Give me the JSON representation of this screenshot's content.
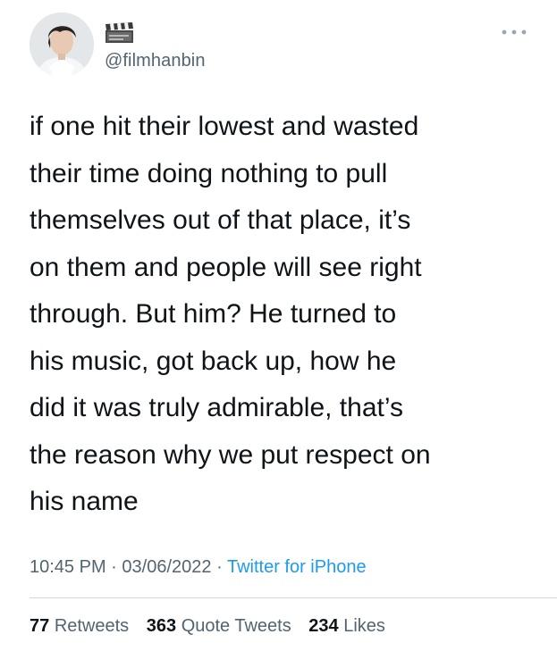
{
  "user": {
    "handle": "@filmhanbin",
    "name_icon": "film-clapper-emoji",
    "avatar_icon": "profile-photo"
  },
  "menu": {
    "icon": "more-options-icon"
  },
  "tweet": {
    "text": "if one hit their lowest and wasted\ntheir time doing nothing to pull\nthemselves out of that place, it’s\non them and people will see right\nthrough. But him? He turned to\nhis music, got back up, how he\ndid it was truly admirable, that’s\nthe reason why we put respect on\nhis name",
    "time": "10:45 PM",
    "date": "03/06/2022",
    "separator": "·",
    "source": "Twitter for iPhone"
  },
  "stats": {
    "retweets_count": "77",
    "retweets_label": "Retweets",
    "quotes_count": "363",
    "quotes_label": "Quote Tweets",
    "likes_count": "234",
    "likes_label": "Likes"
  },
  "colors": {
    "text": "#0f1419",
    "secondary": "#536471",
    "link": "#1d9bf0",
    "divider": "#cfd9de"
  }
}
